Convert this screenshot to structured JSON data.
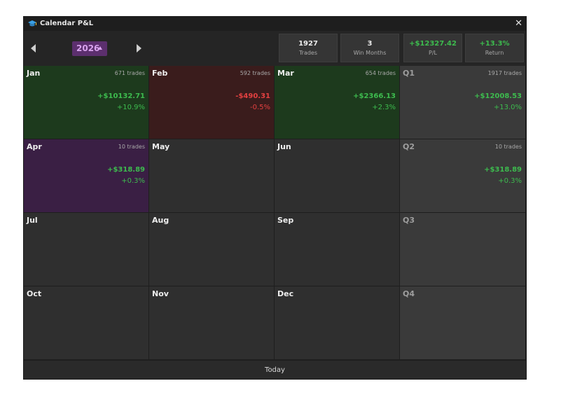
{
  "window": {
    "title": "Calendar P&L",
    "close_glyph": "✕"
  },
  "toolbar": {
    "year": "2026",
    "stats": [
      {
        "value": "1927",
        "label": "Trades",
        "color": "neutral"
      },
      {
        "value": "3",
        "label": "Win Months",
        "color": "neutral"
      },
      {
        "value": "+$12327.42",
        "label": "P/L",
        "color": "green"
      },
      {
        "value": "+13.3%",
        "label": "Return",
        "color": "green"
      }
    ]
  },
  "colors": {
    "profit": "#3dbb4e",
    "loss": "#e34040",
    "year_bg": "#5c2f6e"
  },
  "grid": {
    "rows": [
      [
        {
          "name": "Jan",
          "trades": "671 trades",
          "pl": "+$10132.71",
          "ret": "+10.9%",
          "state": "pos"
        },
        {
          "name": "Feb",
          "trades": "592 trades",
          "pl": "-$490.31",
          "ret": "-0.5%",
          "state": "neg"
        },
        {
          "name": "Mar",
          "trades": "654 trades",
          "pl": "+$2366.13",
          "ret": "+2.3%",
          "state": "pos"
        },
        {
          "name": "Q1",
          "trades": "1917 trades",
          "pl": "+$12008.53",
          "ret": "+13.0%",
          "state": "q"
        }
      ],
      [
        {
          "name": "Apr",
          "trades": "10 trades",
          "pl": "+$318.89",
          "ret": "+0.3%",
          "state": "purple"
        },
        {
          "name": "May",
          "trades": "",
          "pl": "",
          "ret": "",
          "state": "empty"
        },
        {
          "name": "Jun",
          "trades": "",
          "pl": "",
          "ret": "",
          "state": "empty"
        },
        {
          "name": "Q2",
          "trades": "10 trades",
          "pl": "+$318.89",
          "ret": "+0.3%",
          "state": "q"
        }
      ],
      [
        {
          "name": "Jul",
          "trades": "",
          "pl": "",
          "ret": "",
          "state": "empty"
        },
        {
          "name": "Aug",
          "trades": "",
          "pl": "",
          "ret": "",
          "state": "empty"
        },
        {
          "name": "Sep",
          "trades": "",
          "pl": "",
          "ret": "",
          "state": "empty"
        },
        {
          "name": "Q3",
          "trades": "",
          "pl": "",
          "ret": "",
          "state": "q"
        }
      ],
      [
        {
          "name": "Oct",
          "trades": "",
          "pl": "",
          "ret": "",
          "state": "empty"
        },
        {
          "name": "Nov",
          "trades": "",
          "pl": "",
          "ret": "",
          "state": "empty"
        },
        {
          "name": "Dec",
          "trades": "",
          "pl": "",
          "ret": "",
          "state": "empty"
        },
        {
          "name": "Q4",
          "trades": "",
          "pl": "",
          "ret": "",
          "state": "q"
        }
      ]
    ]
  },
  "footer": {
    "today_label": "Today"
  }
}
